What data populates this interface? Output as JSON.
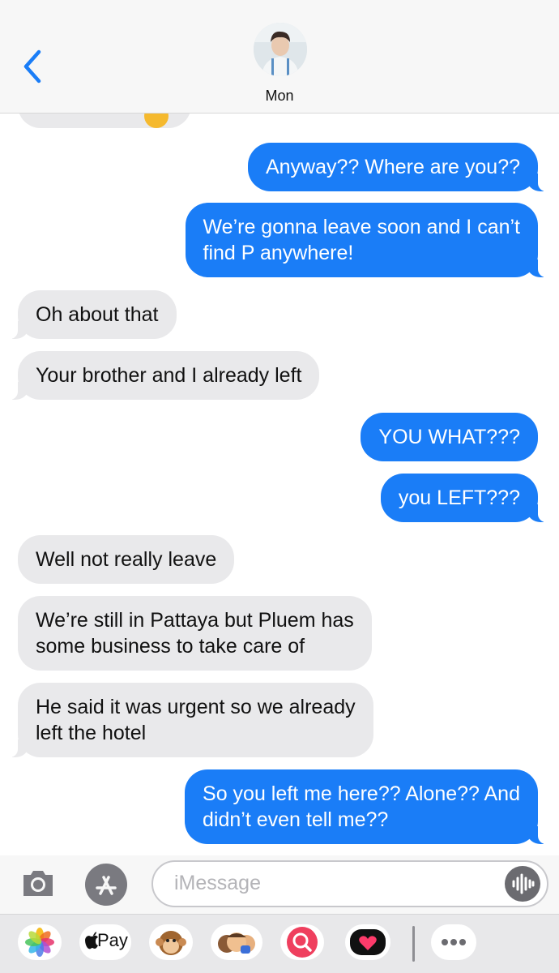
{
  "header": {
    "contact_name": "Mon",
    "back_icon": "chevron-left-icon",
    "accent_color": "#1a7df7"
  },
  "messages": [
    {
      "dir": "out",
      "text": "Anyway?? Where are you??"
    },
    {
      "dir": "out",
      "text": "We’re gonna leave soon and I can’t\nfind P anywhere!"
    },
    {
      "dir": "in",
      "text": "Oh about that"
    },
    {
      "dir": "in",
      "text": "Your brother and I already left"
    },
    {
      "dir": "out",
      "text": "YOU WHAT???"
    },
    {
      "dir": "out",
      "text": "you LEFT???"
    },
    {
      "dir": "in",
      "text": "Well not really leave"
    },
    {
      "dir": "in",
      "text": "We’re still in Pattaya but Pluem has\nsome business to take care of"
    },
    {
      "dir": "in",
      "text": "He said it was urgent so we already\nleft the hotel"
    },
    {
      "dir": "out",
      "text": "So you left me here?? Alone?? And\ndidn’t even tell me??"
    }
  ],
  "input": {
    "placeholder": "iMessage",
    "camera_icon": "camera-icon",
    "apps_icon": "app-store-icon",
    "audio_icon": "audio-waveform-icon"
  },
  "app_drawer": {
    "apple_pay_label": "Pay",
    "apps": [
      "photos-icon",
      "apple-pay-icon",
      "monkey-animoji-icon",
      "memoji-icon",
      "image-search-icon",
      "digital-touch-icon",
      "more-icon"
    ]
  }
}
